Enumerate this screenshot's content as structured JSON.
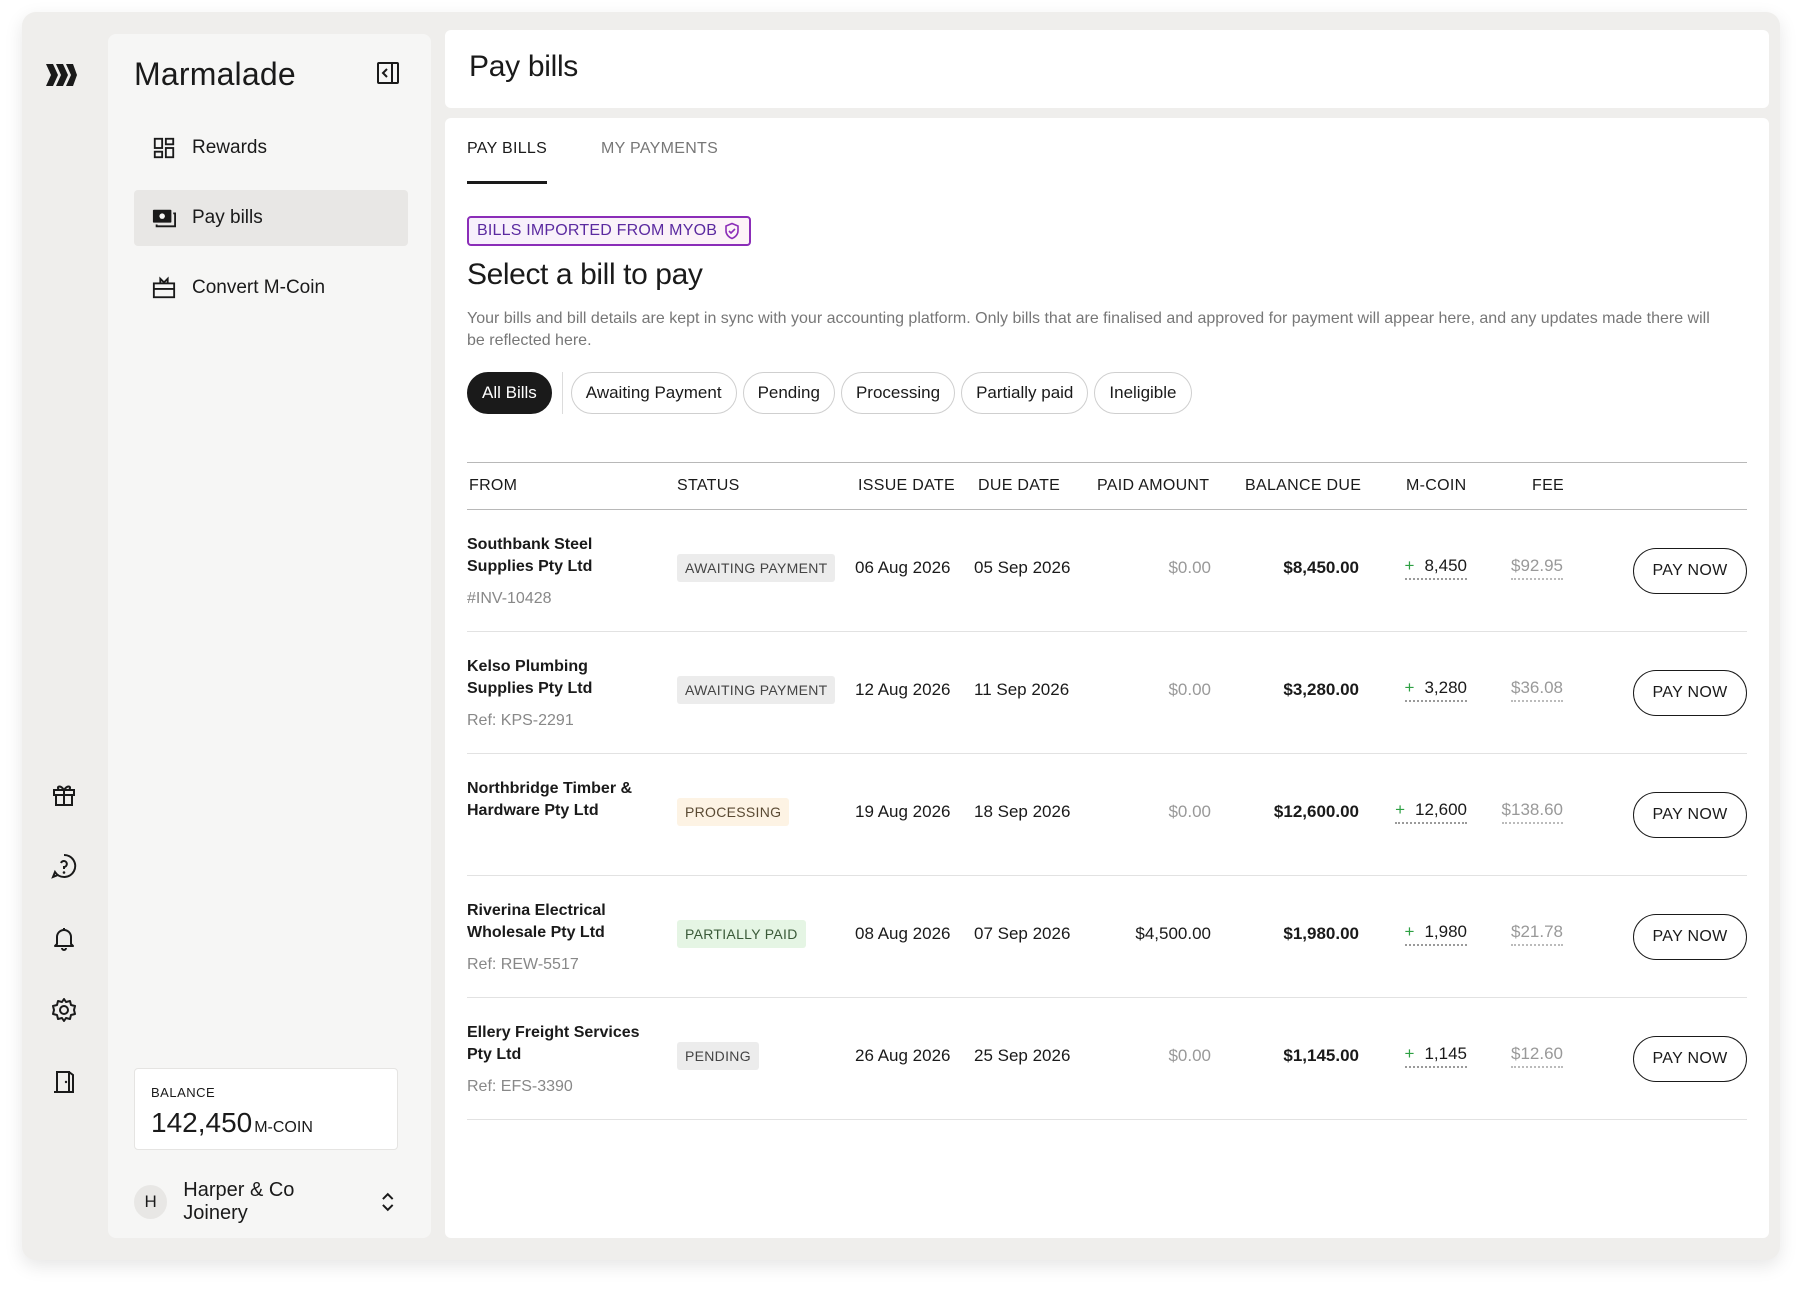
{
  "app": {
    "brand": "Marmalade"
  },
  "rail": {
    "icons": [
      "logo-icon",
      "gift-icon",
      "help-icon",
      "bell-icon",
      "gear-icon",
      "logout-door-icon"
    ]
  },
  "sidebar": {
    "items": [
      {
        "label": "Rewards",
        "icon": "dashboard-grid-icon",
        "active": false
      },
      {
        "label": "Pay bills",
        "icon": "cash-icon",
        "active": true
      },
      {
        "label": "Convert M-Coin",
        "icon": "gift-box-icon",
        "active": false
      }
    ],
    "balance": {
      "label": "BALANCE",
      "value": "142,450",
      "unit": "M-COIN"
    },
    "account": {
      "initial": "H",
      "name": "Harper & Co Joinery"
    }
  },
  "header": {
    "title": "Pay bills"
  },
  "tabs": [
    {
      "label": "PAY BILLS",
      "active": true
    },
    {
      "label": "MY PAYMENTS",
      "active": false
    }
  ],
  "main": {
    "badge": "BILLS IMPORTED FROM MYOB",
    "title": "Select a bill to pay",
    "description": "Your bills and bill details are kept in sync with your accounting platform. Only bills that are finalised and approved for payment will appear here, and any updates made there will be reflected here."
  },
  "filters": {
    "all": "All Bills",
    "options": [
      "Awaiting Payment",
      "Pending",
      "Processing",
      "Partially paid",
      "Ineligible"
    ]
  },
  "table": {
    "headers": {
      "from": "FROM",
      "status": "STATUS",
      "issue": "ISSUE DATE",
      "due": "DUE DATE",
      "paid": "PAID AMOUNT",
      "balance": "BALANCE DUE",
      "mcoin": "M-COIN",
      "fee": "FEE"
    },
    "action_label": "PAY NOW",
    "rows": [
      {
        "from": "Southbank Steel Supplies Pty Ltd",
        "ref": "#INV-10428",
        "status": "AWAITING PAYMENT",
        "status_kind": "awaiting",
        "issue": "06 Aug 2026",
        "due": "05 Sep 2026",
        "paid": "$0.00",
        "balance": "$8,450.00",
        "mcoin_sign": "+",
        "mcoin": "8,450",
        "fee": "$92.95"
      },
      {
        "from": "Kelso Plumbing Supplies Pty Ltd",
        "ref": "Ref: KPS-2291",
        "status": "AWAITING PAYMENT",
        "status_kind": "awaiting",
        "issue": "12 Aug 2026",
        "due": "11 Sep 2026",
        "paid": "$0.00",
        "balance": "$3,280.00",
        "mcoin_sign": "+",
        "mcoin": "3,280",
        "fee": "$36.08"
      },
      {
        "from": "Northbridge Timber & Hardware Pty Ltd",
        "ref": "",
        "status": "PROCESSING",
        "status_kind": "processing",
        "issue": "19 Aug 2026",
        "due": "18 Sep 2026",
        "paid": "$0.00",
        "balance": "$12,600.00",
        "mcoin_sign": "+",
        "mcoin": "12,600",
        "fee": "$138.60"
      },
      {
        "from": "Riverina Electrical Wholesale Pty Ltd",
        "ref": "Ref: REW-5517",
        "status": "PARTIALLY PAID",
        "status_kind": "partial",
        "issue": "08 Aug 2026",
        "due": "07 Sep 2026",
        "paid": "$4,500.00",
        "balance": "$1,980.00",
        "mcoin_sign": "+",
        "mcoin": "1,980",
        "fee": "$21.78"
      },
      {
        "from": "Ellery Freight Services Pty Ltd",
        "ref": "Ref: EFS-3390",
        "status": "PENDING",
        "status_kind": "pending",
        "issue": "26 Aug 2026",
        "due": "25 Sep 2026",
        "paid": "$0.00",
        "balance": "$1,145.00",
        "mcoin_sign": "+",
        "mcoin": "1,145",
        "fee": "$12.60"
      }
    ]
  }
}
